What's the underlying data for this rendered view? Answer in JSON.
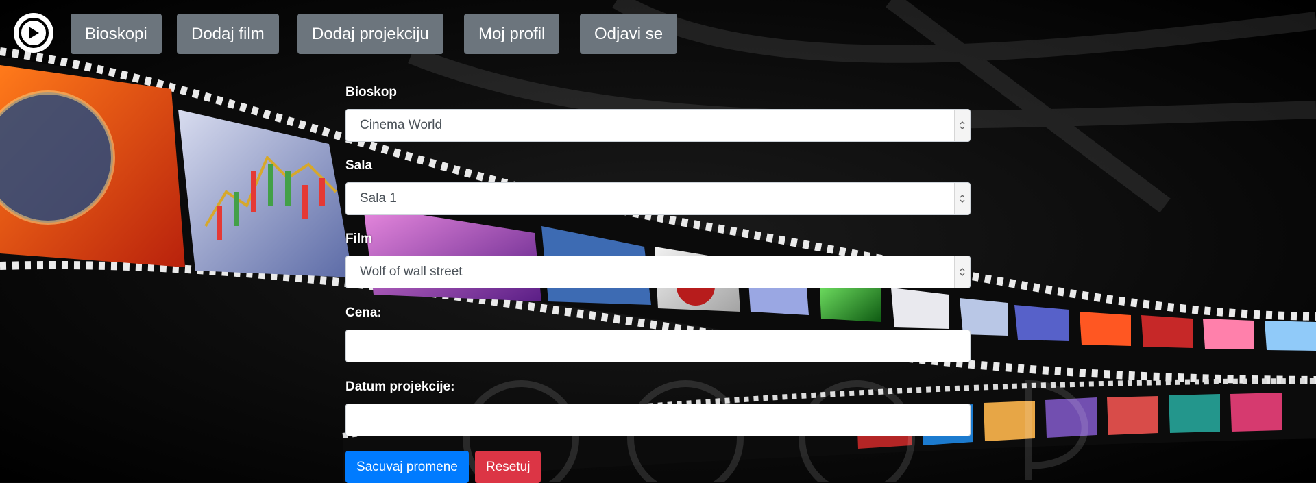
{
  "nav": {
    "logo_icon": "play-circle-icon",
    "items": [
      {
        "label": "Bioskopi"
      },
      {
        "label": "Dodaj film"
      },
      {
        "label": "Dodaj projekciju"
      },
      {
        "label": "Moj profil"
      },
      {
        "label": "Odjavi se"
      }
    ]
  },
  "form": {
    "bioskop": {
      "label": "Bioskop",
      "value": "Cinema World"
    },
    "sala": {
      "label": "Sala",
      "value": "Sala 1"
    },
    "film": {
      "label": "Film",
      "value": "Wolf of wall street"
    },
    "cena": {
      "label": "Cena:",
      "value": ""
    },
    "datum": {
      "label": "Datum projekcije:",
      "value": ""
    },
    "save_label": "Sacuvaj promene",
    "reset_label": "Resetuj"
  },
  "colors": {
    "nav_button": "#6c757d",
    "primary": "#007bff",
    "danger": "#dc3545",
    "background": "#070707"
  }
}
